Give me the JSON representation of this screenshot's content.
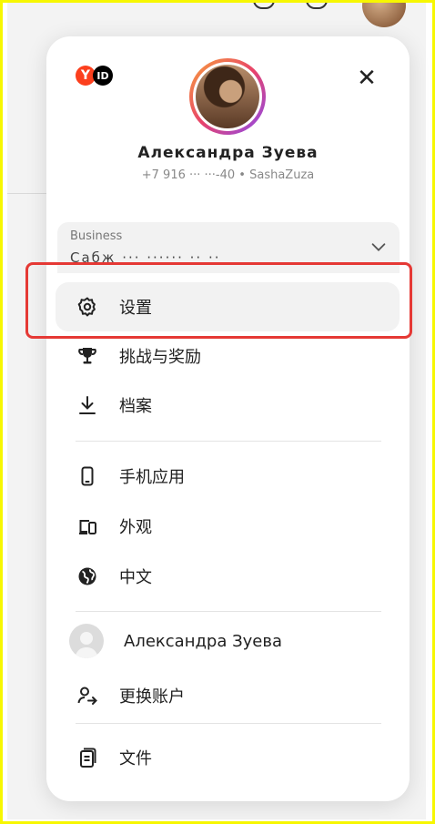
{
  "profile": {
    "name": "Александра Зуева",
    "subtitle": "+7 916 ··· ···-40 • SashaZuza"
  },
  "business": {
    "label": "Business",
    "org_name": "Сабж ··· ······ ·· ··"
  },
  "menu": {
    "settings": "设置",
    "challenges": "挑战与奖励",
    "archive": "档案",
    "mobile_app": "手机应用",
    "appearance": "外观",
    "language": "中文",
    "account_name": "Александра Зуева",
    "switch_account": "更换账户",
    "files": "文件"
  },
  "icons": {
    "settings": "gear-icon",
    "challenges": "trophy-icon",
    "archive": "download-icon",
    "mobile_app": "phone-icon",
    "appearance": "devices-icon",
    "language": "globe-icon",
    "switch_account": "switch-user-icon",
    "files": "files-icon",
    "close": "close-icon",
    "expand": "chevron-down-icon"
  },
  "colors": {
    "highlight": "#e53935",
    "yandex_red": "#fc3f1d",
    "frame": "#f7f700"
  }
}
